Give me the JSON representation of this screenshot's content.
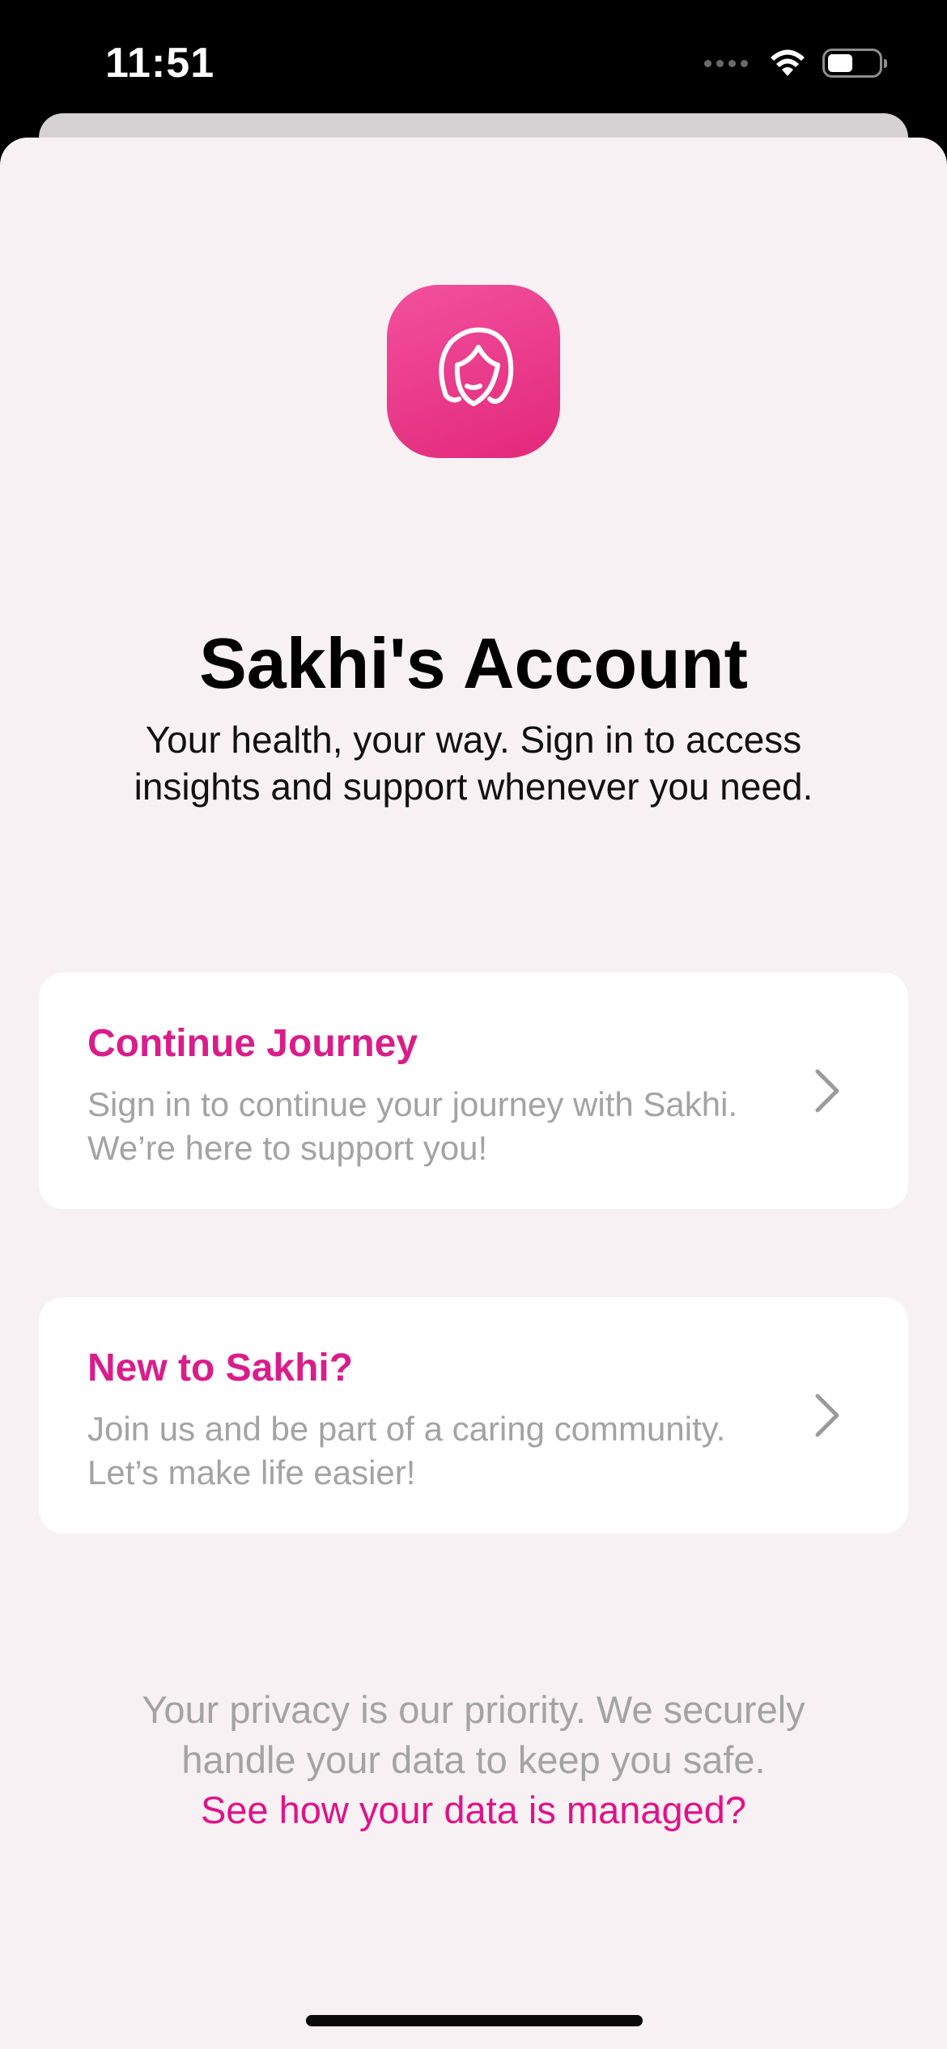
{
  "status_bar": {
    "time": "11:51",
    "icons": [
      "signal-dots-icon",
      "wifi-icon",
      "battery-icon"
    ]
  },
  "app_icon": {
    "name": "woman-face-icon",
    "colors": {
      "gradient_start": "#f2509e",
      "gradient_end": "#e3287a"
    }
  },
  "header": {
    "title": "Sakhi's Account",
    "subtitle": "Your health, your way. Sign in to access insights and support whenever you need."
  },
  "cards": [
    {
      "title": "Continue Journey",
      "description": "Sign in to continue your journey with Sakhi. We’re here to support you!",
      "icon": "chevron-right-icon"
    },
    {
      "title": "New to Sakhi?",
      "description": "Join us and be part of a caring community. Let’s make life easier!",
      "icon": "chevron-right-icon"
    }
  ],
  "privacy": {
    "text": "Your privacy is our priority. We securely handle your data to keep you safe.",
    "link": "See how your data is managed?"
  },
  "colors": {
    "accent": "#d91d8a",
    "link": "#e0128a",
    "background": "#f7f1f3",
    "card": "#ffffff",
    "muted_text": "#a3a3a3"
  }
}
